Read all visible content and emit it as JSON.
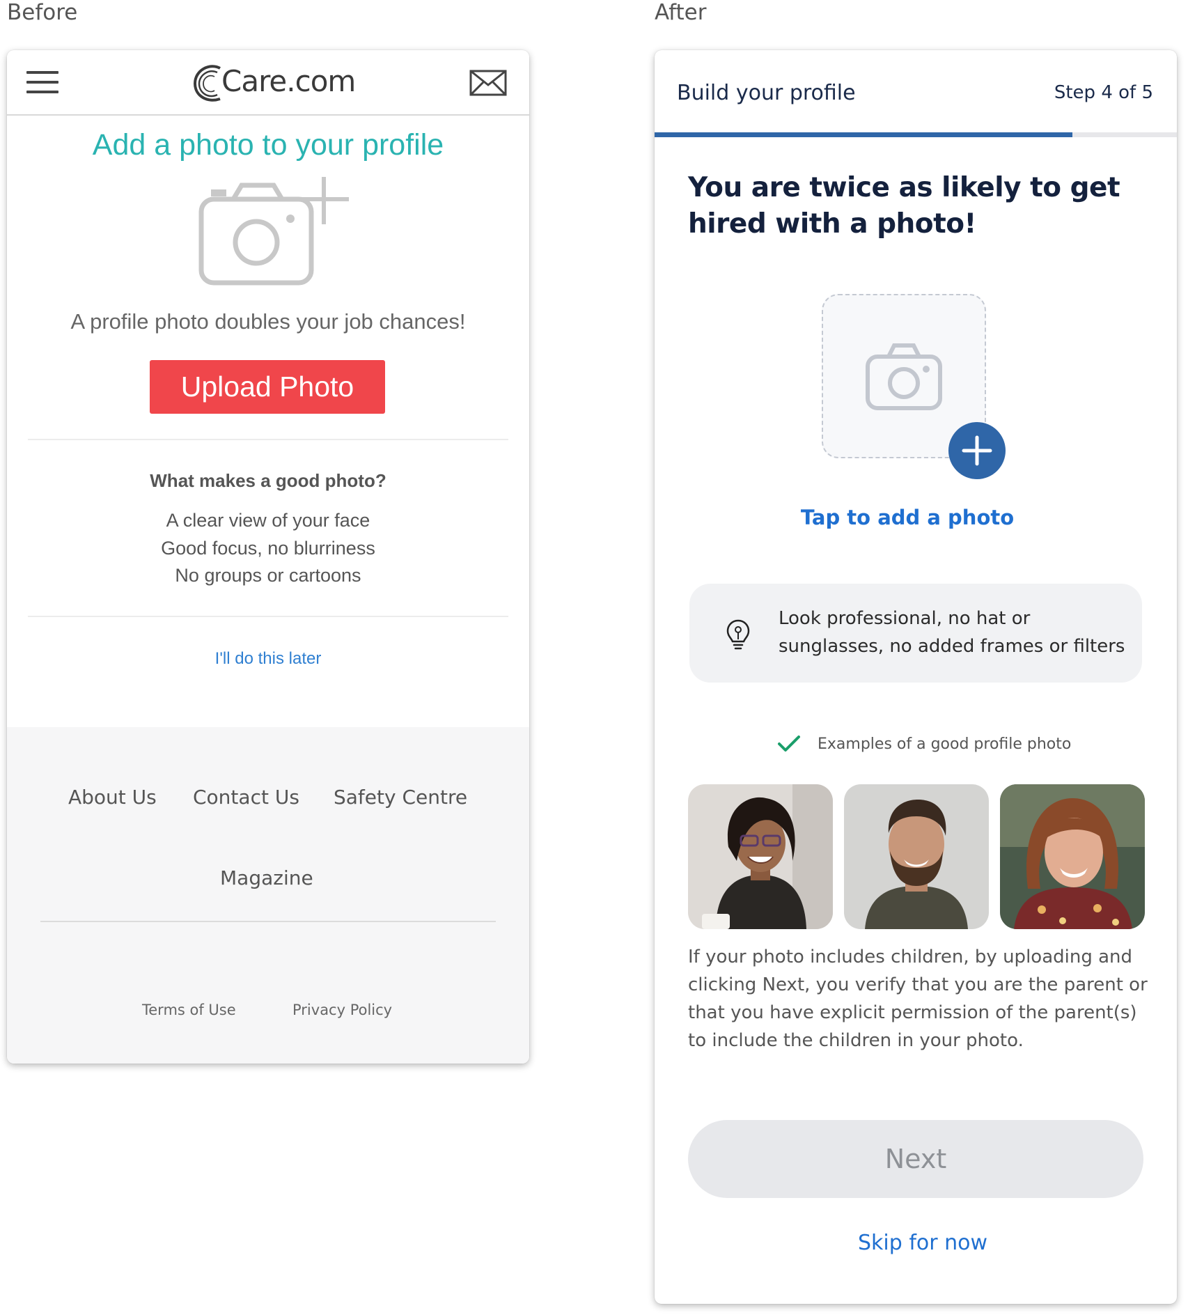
{
  "labels": {
    "before": "Before",
    "after": "After"
  },
  "before": {
    "brand": "Care.com",
    "title": "Add a photo to your profile",
    "subtitle": "A profile photo doubles your job chances!",
    "upload_button": "Upload Photo",
    "good_photo_heading": "What makes a good photo?",
    "tips": [
      "A clear view of your face",
      "Good focus, no blurriness",
      "No groups or cartoons"
    ],
    "later_link": "I'll do this later",
    "footer_links": [
      "About Us",
      "Contact Us",
      "Safety Centre",
      "Magazine"
    ],
    "legal_links": [
      "Terms of Use",
      "Privacy Policy"
    ],
    "colors": {
      "title": "#2ab3b1",
      "upload": "#f0464b",
      "link": "#2f7fd1",
      "footer_bg": "#f6f6f7"
    },
    "icons": [
      "menu-icon",
      "care-logo-icon",
      "mail-icon",
      "camera-plus-icon"
    ]
  },
  "after": {
    "header_title": "Build your profile",
    "step": "Step 4 of 5",
    "progress": 0.8,
    "headline": "You are twice as likely to get hired with a photo!",
    "tap_label": "Tap to add a photo",
    "tip": "Look professional, no hat or sunglasses, no added frames or filters",
    "examples_label": "Examples of a good profile photo",
    "disclaimer": "If your photo includes children, by uploading and clicking Next, you verify that you are the parent or that you have explicit permission of the parent(s) to include the children in your photo.",
    "next_button": "Next",
    "skip_link": "Skip for now",
    "colors": {
      "primary": "#2f66a8",
      "link": "#1f6fd0",
      "check": "#1a9e6a",
      "disabled_bg": "#e7e8eb"
    },
    "icons": [
      "camera-icon",
      "plus-icon",
      "lightbulb-icon",
      "check-icon"
    ]
  }
}
